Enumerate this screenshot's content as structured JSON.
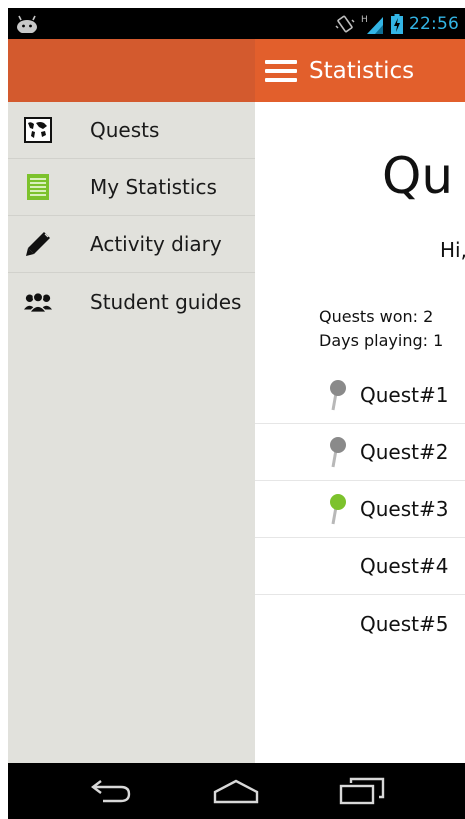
{
  "status_bar": {
    "time": "22:56",
    "network_label": "H",
    "icons": [
      "android-icon",
      "vibrate-icon",
      "signal-icon",
      "battery-charging-icon"
    ]
  },
  "action_bar": {
    "title": "Statistics",
    "menu_icon": "hamburger-menu-icon"
  },
  "drawer": {
    "items": [
      {
        "label": "Quests",
        "icon": "world-map-icon"
      },
      {
        "label": "My Statistics",
        "icon": "notepad-icon"
      },
      {
        "label": "Activity diary",
        "icon": "pencil-icon"
      },
      {
        "label": "Student guides",
        "icon": "group-people-icon"
      }
    ]
  },
  "main": {
    "big_title": "Qu",
    "greeting": "Hi,",
    "quests_won": "Quests won: 2",
    "days_playing": "Days playing: 1",
    "quests": [
      {
        "label": "Quest#1",
        "pin": "gray"
      },
      {
        "label": "Quest#2",
        "pin": "gray"
      },
      {
        "label": "Quest#3",
        "pin": "green"
      },
      {
        "label": "Quest#4",
        "pin": "none"
      },
      {
        "label": "Quest#5",
        "pin": "none"
      }
    ]
  },
  "colors": {
    "action_bar": "#e25f2c",
    "drawer_header": "#d35a2e",
    "drawer_bg": "#e1e1dc",
    "pin_gray": "#8a8a8a",
    "pin_green": "#7cc22c",
    "status_accent": "#33b5e5"
  },
  "nav_bar": {
    "buttons": [
      "back-icon",
      "home-icon",
      "recent-apps-icon"
    ]
  }
}
